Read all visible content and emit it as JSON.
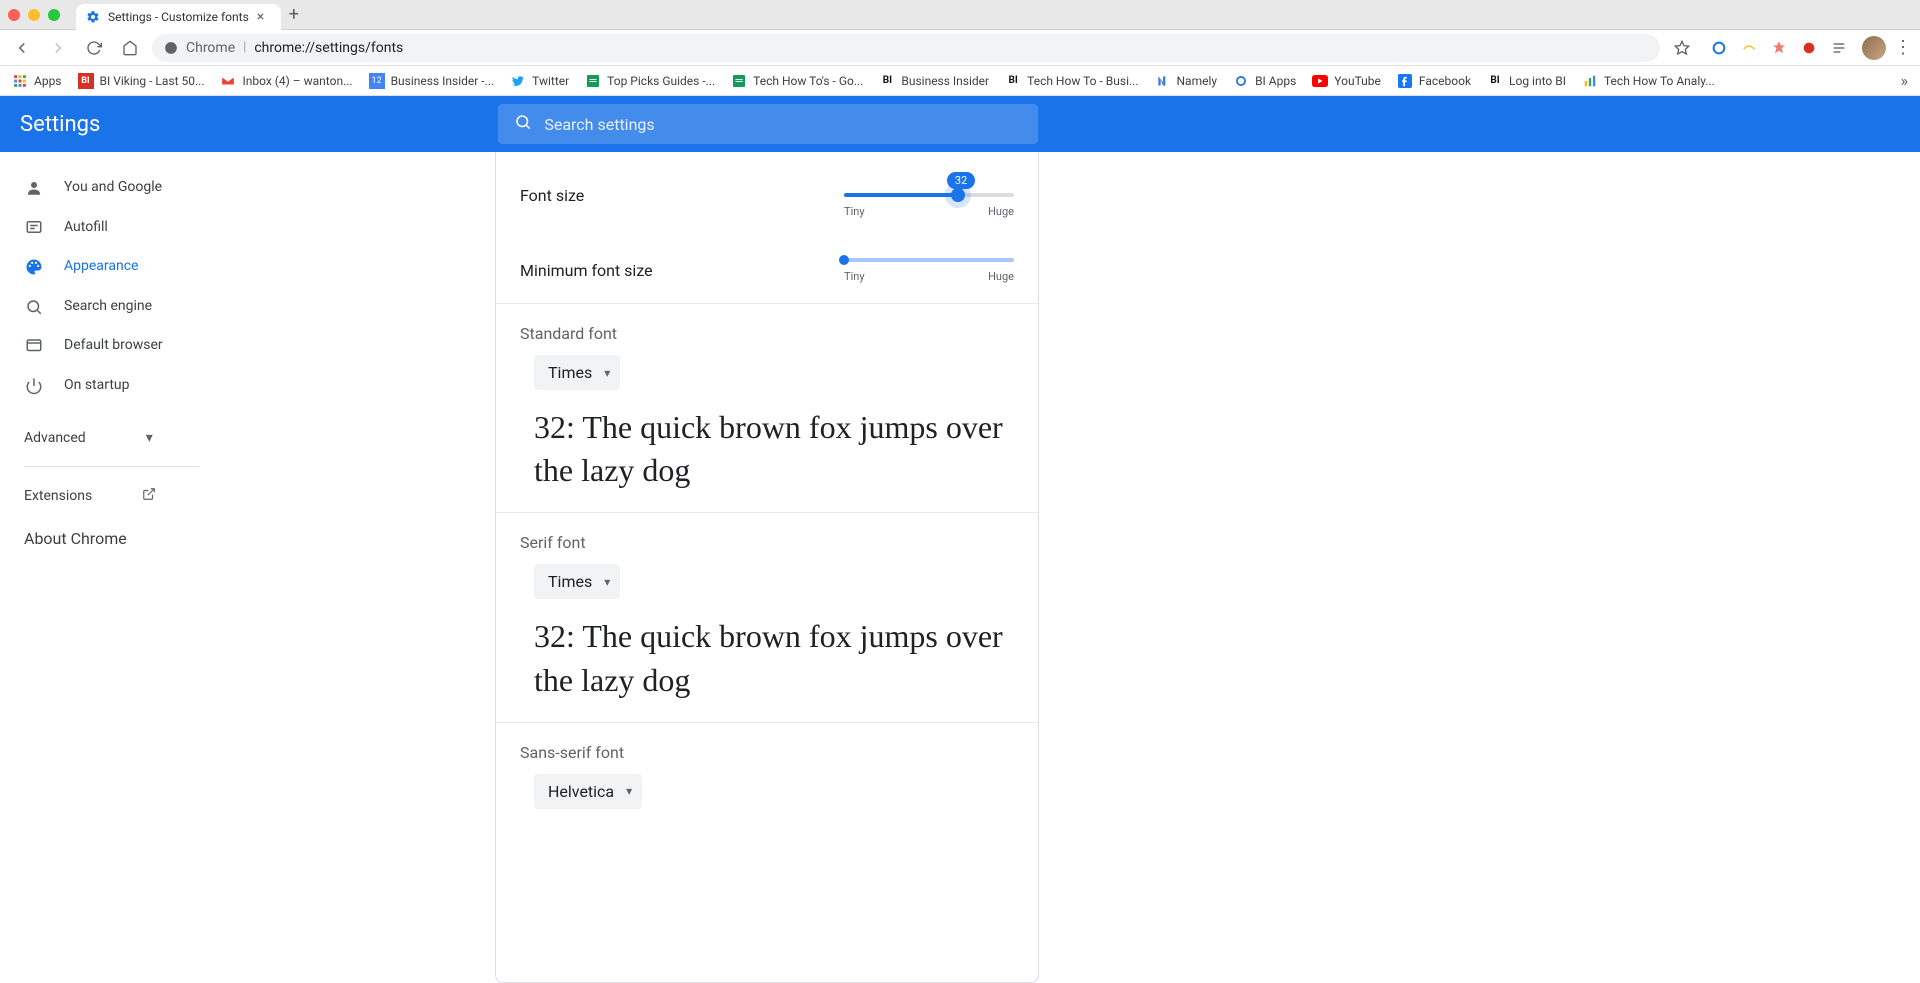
{
  "window": {
    "tab_title": "Settings - Customize fonts"
  },
  "omnibox": {
    "prefix": "Chrome",
    "url": "chrome://settings/fonts"
  },
  "bookmarks": [
    {
      "label": "Apps",
      "icon": "apps"
    },
    {
      "label": "BI Viking - Last 50...",
      "icon": "bi"
    },
    {
      "label": "Inbox (4) – wanton...",
      "icon": "gmail"
    },
    {
      "label": "Business Insider -...",
      "icon": "cal"
    },
    {
      "label": "Twitter",
      "icon": "twitter"
    },
    {
      "label": "Top Picks Guides -...",
      "icon": "sheets"
    },
    {
      "label": "Tech How To's - Go...",
      "icon": "sheets"
    },
    {
      "label": "Business Insider",
      "icon": "bi"
    },
    {
      "label": "Tech How To - Busi...",
      "icon": "bi"
    },
    {
      "label": "Namely",
      "icon": "namely"
    },
    {
      "label": "BI Apps",
      "icon": "biapps"
    },
    {
      "label": "YouTube",
      "icon": "youtube"
    },
    {
      "label": "Facebook",
      "icon": "facebook"
    },
    {
      "label": "Log into BI",
      "icon": "bi"
    },
    {
      "label": "Tech How To Analy...",
      "icon": "analytics"
    }
  ],
  "header": {
    "title": "Settings",
    "search_placeholder": "Search settings"
  },
  "sidebar": {
    "items": [
      {
        "label": "You and Google",
        "icon": "person"
      },
      {
        "label": "Autofill",
        "icon": "autofill"
      },
      {
        "label": "Appearance",
        "icon": "appearance",
        "active": true
      },
      {
        "label": "Search engine",
        "icon": "search"
      },
      {
        "label": "Default browser",
        "icon": "browser"
      },
      {
        "label": "On startup",
        "icon": "power"
      }
    ],
    "advanced": "Advanced",
    "extensions": "Extensions",
    "about": "About Chrome"
  },
  "fonts": {
    "font_size": {
      "label": "Font size",
      "value": 32,
      "min_label": "Tiny",
      "max_label": "Huge",
      "percent": 67
    },
    "min_font_size": {
      "label": "Minimum font size",
      "min_label": "Tiny",
      "max_label": "Huge",
      "percent": 2
    },
    "standard": {
      "title": "Standard font",
      "selected": "Times",
      "preview": "32: The quick brown fox jumps over the lazy dog"
    },
    "serif": {
      "title": "Serif font",
      "selected": "Times",
      "preview": "32: The quick brown fox jumps over the lazy dog"
    },
    "sans": {
      "title": "Sans-serif font",
      "selected": "Helvetica"
    }
  }
}
